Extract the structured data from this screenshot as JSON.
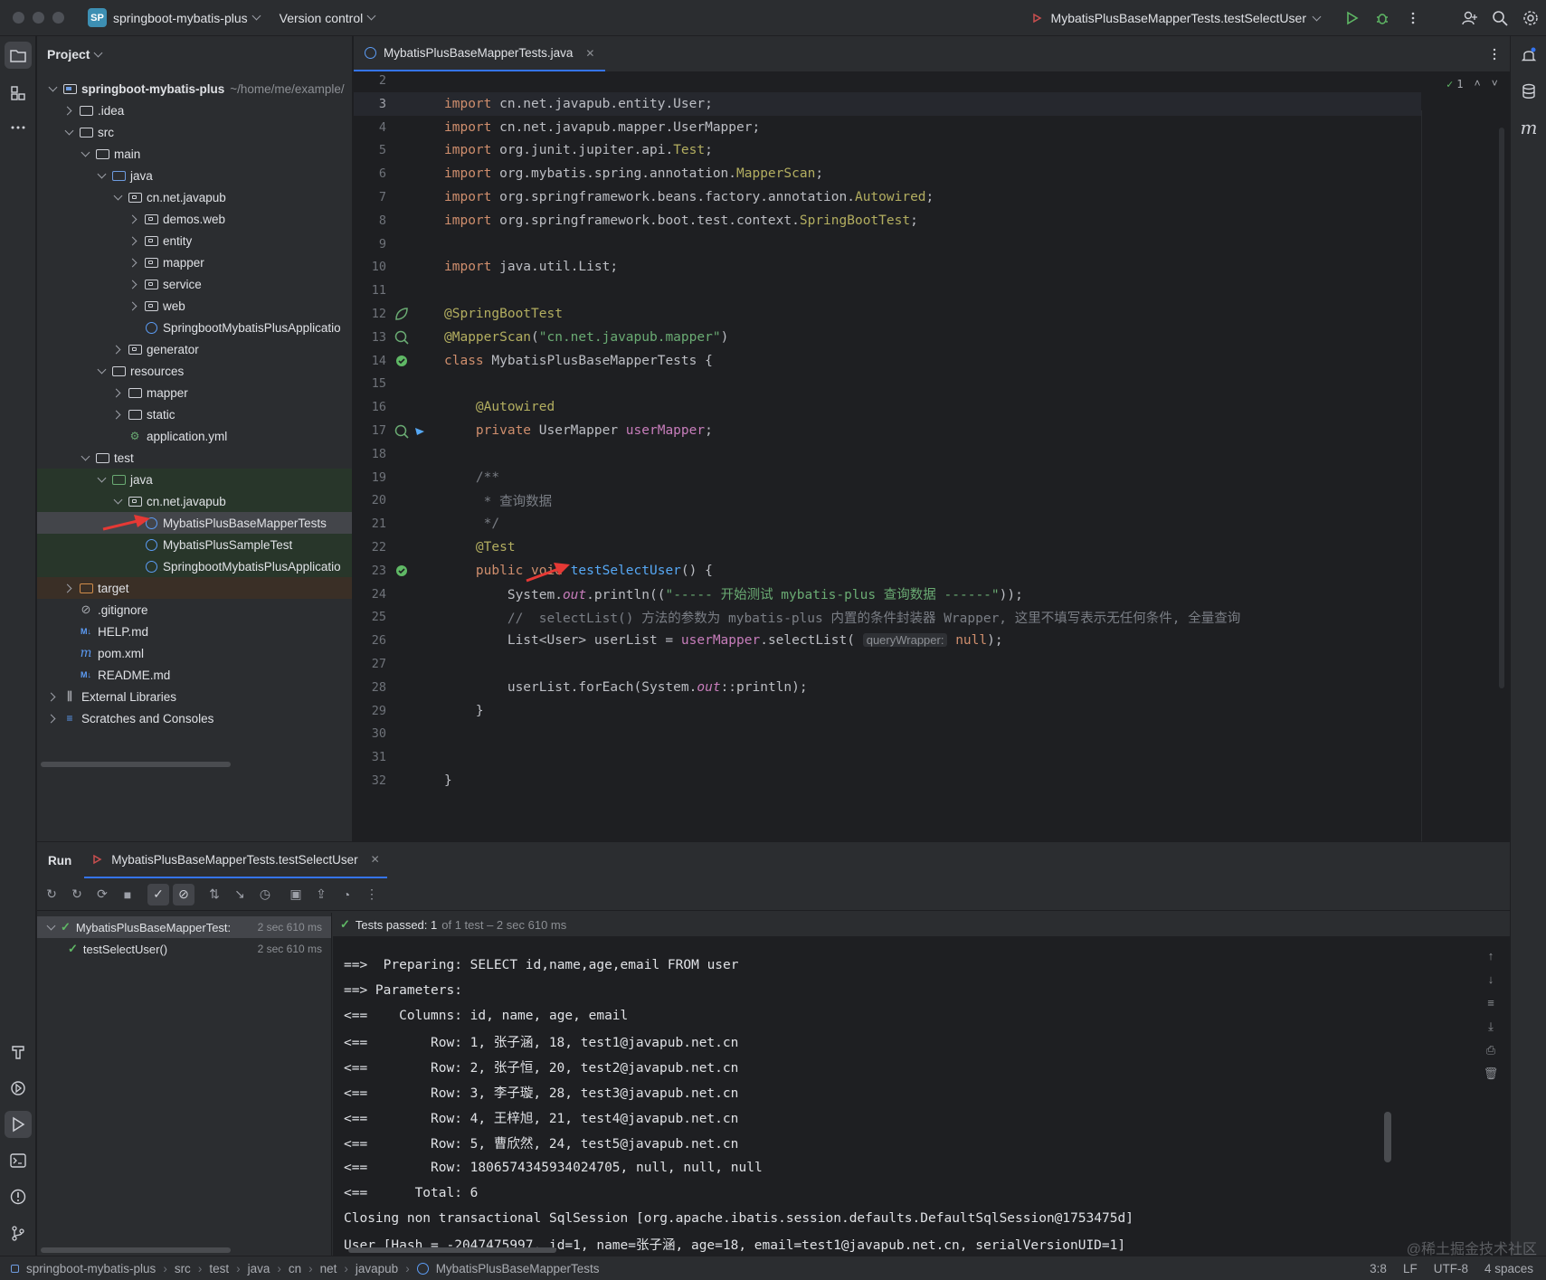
{
  "titlebar": {
    "project_badge": "SP",
    "project_name": "springboot-mybatis-plus",
    "vcs": "Version control",
    "run_config": "MybatisPlusBaseMapperTests.testSelectUser"
  },
  "project_panel": {
    "title": "Project",
    "tree": [
      {
        "label": "springboot-mybatis-plus",
        "extra": "~/home/me/example/",
        "depth": 0,
        "arrow": "open",
        "icon": "module",
        "bold": true
      },
      {
        "label": ".idea",
        "depth": 1,
        "arrow": "closed",
        "icon": "folder"
      },
      {
        "label": "src",
        "depth": 1,
        "arrow": "open",
        "icon": "folder"
      },
      {
        "label": "main",
        "depth": 2,
        "arrow": "open",
        "icon": "folder"
      },
      {
        "label": "java",
        "depth": 3,
        "arrow": "open",
        "icon": "folder-blue"
      },
      {
        "label": "cn.net.javapub",
        "depth": 4,
        "arrow": "open",
        "icon": "package"
      },
      {
        "label": "demos.web",
        "depth": 5,
        "arrow": "closed",
        "icon": "package"
      },
      {
        "label": "entity",
        "depth": 5,
        "arrow": "closed",
        "icon": "package"
      },
      {
        "label": "mapper",
        "depth": 5,
        "arrow": "closed",
        "icon": "package"
      },
      {
        "label": "service",
        "depth": 5,
        "arrow": "closed",
        "icon": "package"
      },
      {
        "label": "web",
        "depth": 5,
        "arrow": "closed",
        "icon": "package"
      },
      {
        "label": "SpringbootMybatisPlusApplicatio",
        "depth": 5,
        "arrow": "none",
        "icon": "class"
      },
      {
        "label": "generator",
        "depth": 4,
        "arrow": "closed",
        "icon": "package"
      },
      {
        "label": "resources",
        "depth": 3,
        "arrow": "open",
        "icon": "folder"
      },
      {
        "label": "mapper",
        "depth": 4,
        "arrow": "closed",
        "icon": "folder"
      },
      {
        "label": "static",
        "depth": 4,
        "arrow": "closed",
        "icon": "folder"
      },
      {
        "label": "application.yml",
        "depth": 4,
        "arrow": "none",
        "icon": "yml"
      },
      {
        "label": "test",
        "depth": 2,
        "arrow": "open",
        "icon": "folder"
      },
      {
        "label": "java",
        "depth": 3,
        "arrow": "open",
        "icon": "folder-green",
        "hl": "test"
      },
      {
        "label": "cn.net.javapub",
        "depth": 4,
        "arrow": "open",
        "icon": "package",
        "hl": "test"
      },
      {
        "label": "MybatisPlusBaseMapperTests",
        "depth": 5,
        "arrow": "none",
        "icon": "class",
        "hl": "selected"
      },
      {
        "label": "MybatisPlusSampleTest",
        "depth": 5,
        "arrow": "none",
        "icon": "class",
        "hl": "test"
      },
      {
        "label": "SpringbootMybatisPlusApplicatio",
        "depth": 5,
        "arrow": "none",
        "icon": "class",
        "hl": "test"
      },
      {
        "label": "target",
        "depth": 1,
        "arrow": "closed",
        "icon": "folder-orange",
        "hl": "target"
      },
      {
        "label": ".gitignore",
        "depth": 1,
        "arrow": "none",
        "icon": "ignore"
      },
      {
        "label": "HELP.md",
        "depth": 1,
        "arrow": "none",
        "icon": "md"
      },
      {
        "label": "pom.xml",
        "depth": 1,
        "arrow": "none",
        "icon": "maven"
      },
      {
        "label": "README.md",
        "depth": 1,
        "arrow": "none",
        "icon": "md"
      },
      {
        "label": "External Libraries",
        "depth": 0,
        "arrow": "closed",
        "icon": "library"
      },
      {
        "label": "Scratches and Consoles",
        "depth": 0,
        "arrow": "closed",
        "icon": "scratch"
      }
    ]
  },
  "editor": {
    "tab": "MybatisPlusBaseMapperTests.java",
    "inspection_count": "1",
    "lines": [
      {
        "n": "2",
        "html": ""
      },
      {
        "n": "3",
        "html": "<span class='k'>import</span> cn.net.javapub.entity.User;",
        "current": true
      },
      {
        "n": "4",
        "html": "<span class='k'>import</span> cn.net.javapub.mapper.UserMapper;"
      },
      {
        "n": "5",
        "html": "<span class='k'>import</span> org.junit.jupiter.api.<span class='a'>Test</span>;"
      },
      {
        "n": "6",
        "html": "<span class='k'>import</span> org.mybatis.spring.annotation.<span class='a'>MapperScan</span>;"
      },
      {
        "n": "7",
        "html": "<span class='k'>import</span> org.springframework.beans.factory.annotation.<span class='a'>Autowired</span>;"
      },
      {
        "n": "8",
        "html": "<span class='k'>import</span> org.springframework.boot.test.context.<span class='a'>SpringBootTest</span>;"
      },
      {
        "n": "9",
        "html": ""
      },
      {
        "n": "10",
        "html": "<span class='k'>import</span> java.util.List;"
      },
      {
        "n": "11",
        "html": ""
      },
      {
        "n": "12",
        "html": "<span class='a'>@SpringBootTest</span>"
      },
      {
        "n": "13",
        "html": "<span class='a'>@MapperScan</span>(<span class='s'>\"cn.net.javapub.mapper\"</span>)"
      },
      {
        "n": "14",
        "html": "<span class='k'>class</span> MybatisPlusBaseMapperTests {"
      },
      {
        "n": "15",
        "html": ""
      },
      {
        "n": "16",
        "html": "    <span class='a'>@Autowired</span>"
      },
      {
        "n": "17",
        "html": "    <span class='k'>private</span> UserMapper <span class='v'>userMapper</span>;"
      },
      {
        "n": "18",
        "html": ""
      },
      {
        "n": "19",
        "html": "    <span class='cm'>/**</span>"
      },
      {
        "n": "20",
        "html": "    <span class='cm'> * 查询数据</span>"
      },
      {
        "n": "21",
        "html": "    <span class='cm'> */</span>"
      },
      {
        "n": "22",
        "html": "    <span class='a'>@Test</span>"
      },
      {
        "n": "23",
        "html": "    <span class='k'>public void</span> <span class='f'>testSelectUser</span>() {"
      },
      {
        "n": "24",
        "html": "        System.<span class='st'>out</span>.println((<span class='s'>\"----- 开始测试 mybatis-plus 查询数据 ------\"</span>));"
      },
      {
        "n": "25",
        "html": "        <span class='cm'>//  selectList() 方法的参数为 mybatis-plus 内置的条件封装器 Wrapper, 这里不填写表示无任何条件, 全量查询</span>"
      },
      {
        "n": "26",
        "html": "        List&lt;User&gt; userList = <span class='v'>userMapper</span>.selectList( <span class='hint'>queryWrapper:</span> <span class='k'>null</span>);"
      },
      {
        "n": "27",
        "html": ""
      },
      {
        "n": "28",
        "html": "        userList.forEach(System.<span class='st'>out</span>::println);"
      },
      {
        "n": "29",
        "html": "    }"
      },
      {
        "n": "30",
        "html": ""
      },
      {
        "n": "31",
        "html": ""
      },
      {
        "n": "32",
        "html": "}"
      }
    ]
  },
  "run": {
    "panel_title": "Run",
    "tab": "MybatisPlusBaseMapperTests.testSelectUser",
    "tests": [
      {
        "label": "MybatisPlusBaseMapperTest:",
        "time": "2 sec 610 ms",
        "depth": 0
      },
      {
        "label": "testSelectUser()",
        "time": "2 sec 610 ms",
        "depth": 1
      }
    ],
    "status_prefix": "Tests passed: 1",
    "status_suffix": "of 1 test – 2 sec 610 ms",
    "console": [
      "==>  Preparing: SELECT id,name,age,email FROM user",
      "==> Parameters: ",
      "<==    Columns: id, name, age, email",
      "<==        Row: 1, 张子涵, 18, test1@javapub.net.cn",
      "<==        Row: 2, 张子恒, 20, test2@javapub.net.cn",
      "<==        Row: 3, 李子璇, 28, test3@javapub.net.cn",
      "<==        Row: 4, 王梓旭, 21, test4@javapub.net.cn",
      "<==        Row: 5, 曹欣然, 24, test5@javapub.net.cn",
      "<==        Row: 1806574345934024705, null, null, null",
      "<==      Total: 6",
      "Closing non transactional SqlSession [org.apache.ibatis.session.defaults.DefaultSqlSession@1753475d]",
      "User [Hash = -2047475997, id=1, name=张子涵, age=18, email=test1@javapub.net.cn, serialVersionUID=1]"
    ]
  },
  "statusbar": {
    "crumbs": [
      "springboot-mybatis-plus",
      "src",
      "test",
      "java",
      "cn",
      "net",
      "javapub",
      "MybatisPlusBaseMapperTests"
    ],
    "position": "3:8",
    "line_sep": "LF",
    "encoding": "UTF-8",
    "indent": "4 spaces",
    "watermark": "@稀土掘金技术社区"
  },
  "colors": {
    "accent": "#3574f0",
    "pass": "#5fb865",
    "annotation_arrow": "#e53935"
  }
}
